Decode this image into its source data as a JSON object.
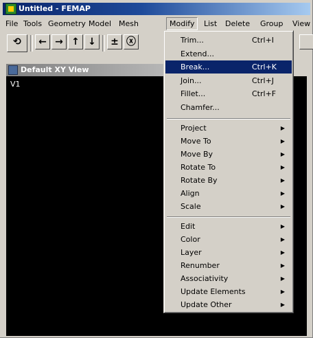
{
  "window": {
    "title": "Untitled - FEMAP"
  },
  "menubar": [
    "File",
    "Tools",
    "Geometry",
    "Model",
    "Mesh",
    "Modify",
    "List",
    "Delete",
    "Group",
    "View"
  ],
  "toolbar": {
    "buttons": [
      {
        "name": "rotate-view-button",
        "glyph": "⟲"
      },
      {
        "name": "left-arrow-button",
        "glyph": "←"
      },
      {
        "name": "right-arrow-button",
        "glyph": "→"
      },
      {
        "name": "up-arrow-button",
        "glyph": "↑"
      },
      {
        "name": "down-arrow-button",
        "glyph": "↓"
      },
      {
        "name": "plus-minus-button",
        "glyph": "±"
      },
      {
        "name": "rotate-x-button",
        "glyph": "ⓧ"
      }
    ]
  },
  "view": {
    "title": "Default XY View",
    "label": "V1",
    "background": "#000000"
  },
  "modify_menu": {
    "items": [
      {
        "label": "Trim...",
        "shortcut": "Ctrl+I",
        "submenu": false,
        "highlight": false
      },
      {
        "label": "Extend...",
        "shortcut": "",
        "submenu": false,
        "highlight": false
      },
      {
        "label": "Break...",
        "shortcut": "Ctrl+K",
        "submenu": false,
        "highlight": true
      },
      {
        "label": "Join...",
        "shortcut": "Ctrl+J",
        "submenu": false,
        "highlight": false
      },
      {
        "label": "Fillet...",
        "shortcut": "Ctrl+F",
        "submenu": false,
        "highlight": false
      },
      {
        "label": "Chamfer...",
        "shortcut": "",
        "submenu": false,
        "highlight": false
      },
      {
        "separator": true
      },
      {
        "label": "Project",
        "submenu": true
      },
      {
        "label": "Move To",
        "submenu": true
      },
      {
        "label": "Move By",
        "submenu": true
      },
      {
        "label": "Rotate To",
        "submenu": true
      },
      {
        "label": "Rotate By",
        "submenu": true
      },
      {
        "label": "Align",
        "submenu": true
      },
      {
        "label": "Scale",
        "submenu": true
      },
      {
        "separator": true
      },
      {
        "label": "Edit",
        "submenu": true
      },
      {
        "label": "Color",
        "submenu": true
      },
      {
        "label": "Layer",
        "submenu": true
      },
      {
        "label": "Renumber",
        "submenu": true
      },
      {
        "label": "Associativity",
        "submenu": true
      },
      {
        "label": "Update Elements",
        "submenu": true
      },
      {
        "label": "Update Other",
        "submenu": true
      }
    ]
  },
  "colors": {
    "title_active": "#0a246a",
    "menu_highlight": "#0a246a",
    "face": "#d4d0c8"
  }
}
